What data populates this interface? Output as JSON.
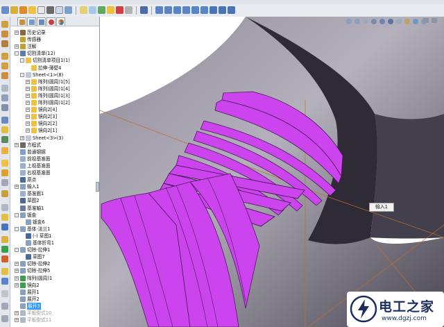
{
  "tree": {
    "items": [
      {
        "label": "历史记录",
        "indent": 0,
        "exp": "+",
        "icon": "history-icon",
        "color": "#8a6a3a"
      },
      {
        "label": "传感器",
        "indent": 0,
        "exp": "",
        "icon": "sensor-icon",
        "color": "#c8a030"
      },
      {
        "label": "注解",
        "indent": 0,
        "exp": "+",
        "icon": "annotation-icon",
        "color": "#c8a030"
      },
      {
        "label": "切割清单(12)",
        "indent": 0,
        "exp": "-",
        "icon": "cut-list-icon",
        "color": "#5b7bb5"
      },
      {
        "label": "切割清单项目1(1)",
        "indent": 1,
        "exp": "-",
        "icon": "folder-icon",
        "color": "#f0c040"
      },
      {
        "label": "拉伸-薄壁4",
        "indent": 2,
        "exp": "",
        "icon": "body-icon",
        "color": "#f0c040"
      },
      {
        "label": "Sheet<1>(8)",
        "indent": 1,
        "exp": "-",
        "icon": "folder-icon",
        "color": "#bfc8d8"
      },
      {
        "label": "阵列(圆周)1[5]",
        "indent": 2,
        "exp": "+",
        "icon": "body-icon",
        "color": "#f0c040"
      },
      {
        "label": "阵列(圆周)1[4]",
        "indent": 2,
        "exp": "+",
        "icon": "body-icon",
        "color": "#f0c040"
      },
      {
        "label": "阵列(圆周)1[3]",
        "indent": 2,
        "exp": "+",
        "icon": "body-icon",
        "color": "#f0c040"
      },
      {
        "label": "阵列(圆周)1[2]",
        "indent": 2,
        "exp": "+",
        "icon": "body-icon",
        "color": "#f0c040"
      },
      {
        "label": "镜向2[4]",
        "indent": 2,
        "exp": "+",
        "icon": "body-icon",
        "color": "#f0c040"
      },
      {
        "label": "镜向2[3]",
        "indent": 2,
        "exp": "+",
        "icon": "body-icon",
        "color": "#f0c040"
      },
      {
        "label": "镜向2[2]",
        "indent": 2,
        "exp": "+",
        "icon": "body-icon",
        "color": "#f0c040"
      },
      {
        "label": "镜向2[1]",
        "indent": 2,
        "exp": "+",
        "icon": "body-icon",
        "color": "#f0c040"
      },
      {
        "label": "Sheet<3>(3)",
        "indent": 1,
        "exp": "+",
        "icon": "folder-icon",
        "color": "#bfc8d8"
      },
      {
        "label": "方程式",
        "indent": 0,
        "exp": "+",
        "icon": "equation-icon",
        "color": "#6a6a6a"
      },
      {
        "label": "普通钢钢",
        "indent": 0,
        "exp": "",
        "icon": "material-icon",
        "color": "#7aa0d0"
      },
      {
        "label": "前视基准面",
        "indent": 0,
        "exp": "",
        "icon": "plane-icon",
        "color": "#9ab0d0"
      },
      {
        "label": "上视基准面",
        "indent": 0,
        "exp": "",
        "icon": "plane-icon",
        "color": "#9ab0d0"
      },
      {
        "label": "右视基准面",
        "indent": 0,
        "exp": "",
        "icon": "plane-icon",
        "color": "#9ab0d0"
      },
      {
        "label": "原点",
        "indent": 0,
        "exp": "",
        "icon": "origin-icon",
        "color": "#4a6a9a"
      },
      {
        "label": "输入1",
        "indent": 0,
        "exp": "+",
        "icon": "import-icon",
        "color": "#8aa0c0"
      },
      {
        "label": "基准面1",
        "indent": 0,
        "exp": "",
        "icon": "plane-icon",
        "color": "#9ab0d0"
      },
      {
        "label": "草图2",
        "indent": 0,
        "exp": "",
        "icon": "sketch-icon",
        "color": "#4a6a9a"
      },
      {
        "label": "基准轴1",
        "indent": 0,
        "exp": "",
        "icon": "axis-icon",
        "color": "#6a7a9a"
      },
      {
        "label": "钣金",
        "indent": 0,
        "exp": "-",
        "icon": "sheetmetal-icon",
        "color": "#8aa0c0"
      },
      {
        "label": "钣金6",
        "indent": 1,
        "exp": "",
        "icon": "sheetmetal-icon",
        "color": "#8aa0c0"
      },
      {
        "label": "基体-法兰1",
        "indent": 0,
        "exp": "-",
        "icon": "base-flange-icon",
        "color": "#8aa0c0"
      },
      {
        "label": "(-) 草图1",
        "indent": 1,
        "exp": "",
        "icon": "sketch-icon",
        "color": "#4a6a9a"
      },
      {
        "label": "基体折弯1",
        "indent": 1,
        "exp": "",
        "icon": "bend-icon",
        "color": "#8aa0c0"
      },
      {
        "label": "切除-拉伸1",
        "indent": 0,
        "exp": "-",
        "icon": "cut-extrude-icon",
        "color": "#8aa0c0"
      },
      {
        "label": "草图7",
        "indent": 1,
        "exp": "",
        "icon": "sketch-icon",
        "color": "#4a6a9a"
      },
      {
        "label": "切除-拉伸2",
        "indent": 0,
        "exp": "+",
        "icon": "cut-extrude-icon",
        "color": "#8aa0c0"
      },
      {
        "label": "切除-拉伸5",
        "indent": 0,
        "exp": "+",
        "icon": "cut-extrude-icon",
        "color": "#8aa0c0"
      },
      {
        "label": "阵列(圆周)1",
        "indent": 0,
        "exp": "+",
        "icon": "pattern-icon",
        "color": "#3aa04a"
      },
      {
        "label": "镜向2",
        "indent": 0,
        "exp": "+",
        "icon": "mirror-icon",
        "color": "#3aa04a"
      },
      {
        "label": "展开1",
        "indent": 0,
        "exp": "",
        "icon": "unfold-icon",
        "color": "#8aa0c0"
      },
      {
        "label": "展开2",
        "indent": 0,
        "exp": "",
        "icon": "unfold-icon",
        "color": "#8aa0c0"
      },
      {
        "label": "展开3",
        "indent": 0,
        "exp": "",
        "icon": "unfold-icon",
        "color": "#8aa0c0",
        "selected": true
      },
      {
        "label": "平板型式10",
        "indent": 0,
        "exp": "+",
        "icon": "flat-pattern-icon",
        "color": "#b0b8c8",
        "dim": true
      },
      {
        "label": "平板型式11",
        "indent": 0,
        "exp": "+",
        "icon": "flat-pattern-icon",
        "color": "#b0b8c8",
        "dim": true
      }
    ]
  },
  "viewport": {
    "callout_label": "输入1",
    "part_color": "#cc44ee"
  },
  "watermark": {
    "title": "电工之家",
    "url": "www.dgzj.com"
  }
}
